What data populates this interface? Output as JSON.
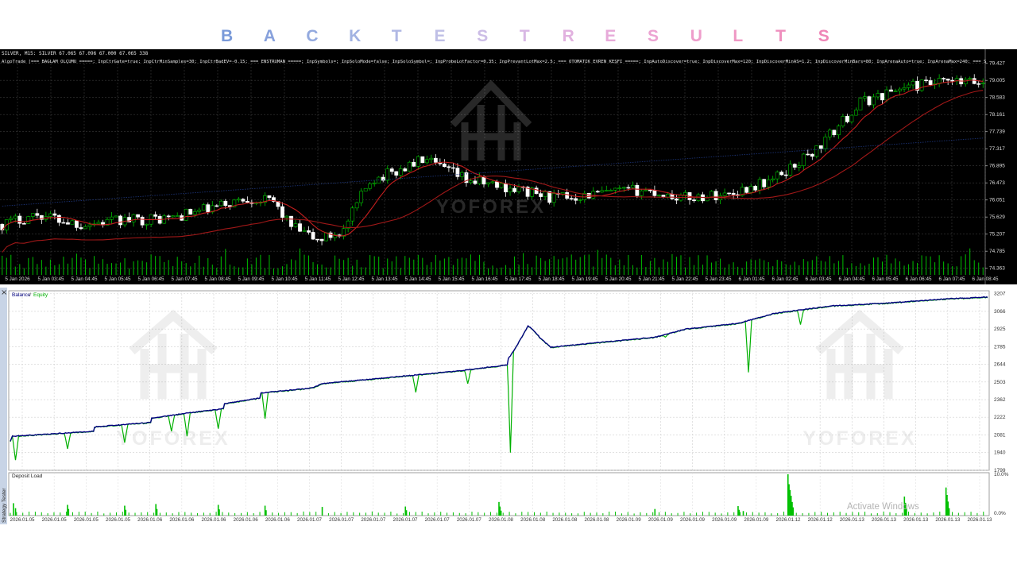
{
  "banner": {
    "title_letters": [
      "B",
      "A",
      "C",
      "K",
      "T",
      "E",
      "S",
      "T",
      "R",
      "E",
      "S",
      "U",
      "L",
      "T",
      "S"
    ],
    "title_colors": [
      "#7a9ad9",
      "#87a1dc",
      "#94aadf",
      "#a1b2e2",
      "#b0b8e4",
      "#bfbfe6",
      "#ccbde6",
      "#d8b7e4",
      "#e1b1df",
      "#e7aad9",
      "#ecA3d2",
      "#ee9dcb",
      "#ef97c4",
      "#ef8fbe",
      "#ef86b7"
    ]
  },
  "chart_window": {
    "info_line": "SILVER, M15: SILVER  67.065 67.096 67.000 67.065  338",
    "params_line": "AlgoTrade [=== BAĞLAM OLÇUMU =====; InpCtrGate=true; InpCtrMinSamples=30; InpCtrBadEV=-0.15; === ENSTRUMAN =====; InpSymbols=; InpSoloMode=false; InpSoloSymbol=; InpProbeLotFactor=0.35; InpPrevantLotMax=2.5; === OTOMATIK EVREN KEŞFİ =====; InpAutoDiscover=true; InpDiscoverMax=120; InpDiscoverMinAS=1.2; InpDiscoverMinBars=80; InpArenaAuto=true; InpArenaMax=240; === SİNYAL ====;",
    "watermark_text": "YOFOREX"
  },
  "chart_data": [
    {
      "type": "candlestick",
      "title": "SILVER, M15",
      "symbol": "SILVER",
      "timeframe": "M15",
      "y_ticks": [
        "79.427",
        "79.005",
        "78.583",
        "78.161",
        "77.739",
        "77.317",
        "76.895",
        "76.473",
        "76.051",
        "75.629",
        "75.207",
        "74.785",
        "74.363"
      ],
      "ylim": [
        74.2,
        79.5
      ],
      "x_ticks": [
        "5 Jan 2026",
        "5 Jan 03:45",
        "5 Jan 04:45",
        "5 Jan 05:45",
        "5 Jan 06:45",
        "5 Jan 07:45",
        "5 Jan 08:45",
        "5 Jan 09:45",
        "5 Jan 10:45",
        "5 Jan 11:45",
        "5 Jan 12:45",
        "5 Jan 13:45",
        "5 Jan 14:45",
        "5 Jan 15:45",
        "5 Jan 16:45",
        "5 Jan 17:45",
        "5 Jan 18:45",
        "5 Jan 19:45",
        "5 Jan 20:45",
        "5 Jan 21:45",
        "5 Jan 22:45",
        "5 Jan 23:45",
        "6 Jan 01:45",
        "6 Jan 02:45",
        "6 Jan 03:45",
        "6 Jan 04:45",
        "6 Jan 05:45",
        "6 Jan 06:45",
        "6 Jan 07:45",
        "6 Jan 08:45"
      ],
      "close_anchors": [
        [
          0,
          75.45
        ],
        [
          8,
          75.7
        ],
        [
          18,
          75.45
        ],
        [
          28,
          75.55
        ],
        [
          38,
          75.6
        ],
        [
          48,
          75.85
        ],
        [
          56,
          76.1
        ],
        [
          62,
          76.0
        ],
        [
          66,
          75.4
        ],
        [
          72,
          75.05
        ],
        [
          78,
          75.3
        ],
        [
          84,
          76.55
        ],
        [
          90,
          76.75
        ],
        [
          96,
          77.05
        ],
        [
          100,
          76.85
        ],
        [
          106,
          76.55
        ],
        [
          116,
          76.35
        ],
        [
          126,
          76.1
        ],
        [
          136,
          76.2
        ],
        [
          146,
          76.3
        ],
        [
          156,
          76.1
        ],
        [
          166,
          76.2
        ],
        [
          176,
          76.55
        ],
        [
          186,
          77.3
        ],
        [
          196,
          78.45
        ],
        [
          206,
          78.85
        ],
        [
          216,
          78.95
        ],
        [
          224,
          78.95
        ]
      ],
      "candle_count": 225,
      "ma_colors": {
        "fast": "#c41e1e",
        "slow": "#a01818",
        "long": "#1a3070"
      },
      "bull_color": "#00c000",
      "bear_color": "#ffffff",
      "volume_color": "#00c000"
    },
    {
      "type": "line",
      "legend": [
        "Balance",
        "Equity"
      ],
      "series_colors": {
        "Balance": "#00007f",
        "Equity": "#00b000"
      },
      "y_ticks": [
        "3207",
        "3066",
        "2925",
        "2785",
        "2644",
        "2503",
        "2362",
        "2222",
        "2081",
        "1940",
        "1799"
      ],
      "ylim": [
        1799,
        3230
      ],
      "x_ticks": [
        "2026.01.05",
        "2026.01.05",
        "2026.01.05",
        "2026.01.05",
        "2026.01.06",
        "2026.01.06",
        "2026.01.06",
        "2026.01.06",
        "2026.01.06",
        "2026.01.07",
        "2026.01.07",
        "2026.01.07",
        "2026.01.07",
        "2026.01.07",
        "2026.01.07",
        "2026.01.08",
        "2026.01.08",
        "2026.01.08",
        "2026.01.08",
        "2026.01.09",
        "2026.01.09",
        "2026.01.09",
        "2026.01.09",
        "2026.01.09",
        "2026.01.12",
        "2026.01.12",
        "2026.01.13",
        "2026.01.13",
        "2026.01.13",
        "2026.01.13",
        "2026.01.13"
      ],
      "balance_anchors": [
        [
          0,
          2030
        ],
        [
          2,
          2070
        ],
        [
          80,
          2110
        ],
        [
          81,
          2145
        ],
        [
          135,
          2180
        ],
        [
          136,
          2215
        ],
        [
          170,
          2255
        ],
        [
          205,
          2290
        ],
        [
          206,
          2330
        ],
        [
          240,
          2375
        ],
        [
          241,
          2415
        ],
        [
          290,
          2455
        ],
        [
          300,
          2490
        ],
        [
          360,
          2535
        ],
        [
          430,
          2590
        ],
        [
          450,
          2610
        ],
        [
          478,
          2640
        ],
        [
          479,
          2690
        ],
        [
          485,
          2760
        ],
        [
          498,
          2950
        ],
        [
          505,
          2900
        ],
        [
          510,
          2850
        ],
        [
          520,
          2780
        ],
        [
          620,
          2860
        ],
        [
          650,
          2925
        ],
        [
          700,
          2970
        ],
        [
          735,
          3050
        ],
        [
          790,
          3110
        ],
        [
          840,
          3130
        ],
        [
          900,
          3165
        ],
        [
          940,
          3180
        ]
      ],
      "equity_dips": [
        [
          5,
          1880
        ],
        [
          55,
          1970
        ],
        [
          110,
          2020
        ],
        [
          155,
          2110
        ],
        [
          170,
          2070
        ],
        [
          200,
          2130
        ],
        [
          245,
          2210
        ],
        [
          390,
          2420
        ],
        [
          440,
          2490
        ],
        [
          481,
          1940
        ],
        [
          580,
          2830
        ],
        [
          630,
          2860
        ],
        [
          710,
          2580
        ],
        [
          760,
          2960
        ]
      ],
      "legend_labels": {
        "balance": "Balance",
        "equity": "Equity"
      }
    },
    {
      "type": "bar",
      "title": "Deposit Load",
      "y_ticks": [
        "10.0%",
        "0.0%"
      ],
      "ylim": [
        0,
        10
      ],
      "bar_color": "#00c000",
      "peak_load": 10.0
    }
  ],
  "tester": {
    "deposit_load_label": "Deposit Load",
    "side_tab": "Strategy Tester",
    "close_icon": "×",
    "activate_windows": "Activate Windows"
  }
}
